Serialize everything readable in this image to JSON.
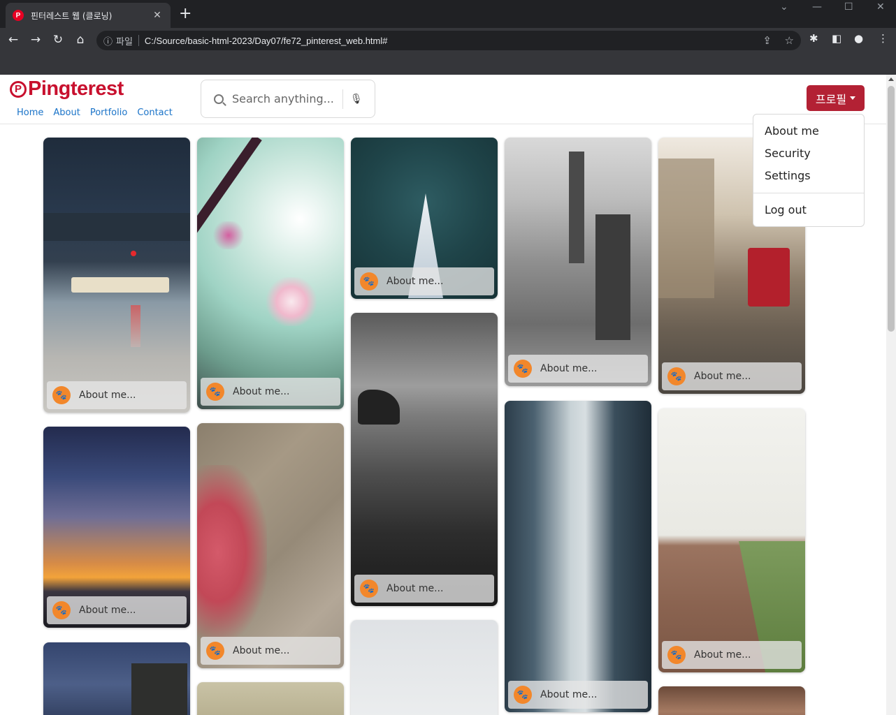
{
  "browser": {
    "tab_title": "핀터레스트 웹 (클로닝)",
    "tab_favicon": "P",
    "new_tab": "+",
    "close": "✕",
    "url_scheme_label": "파일",
    "url": "C:/Source/basic-html-2023/Day07/fe72_pinterest_web.html#"
  },
  "header": {
    "logo_mark": "P",
    "logo_text": "Pingterest",
    "nav": [
      "Home",
      "About",
      "Portfolio",
      "Contact"
    ],
    "search_placeholder": "Search anything...",
    "profile_button": "프로필"
  },
  "dropdown": {
    "items": [
      "About me",
      "Security",
      "Settings"
    ],
    "logout": "Log out"
  },
  "pins": [
    {
      "caption": "About me..."
    },
    {
      "caption": "About me..."
    },
    {
      "caption": "About me..."
    },
    {
      "caption": "About me..."
    },
    {
      "caption": "About me..."
    },
    {
      "caption": "About me..."
    },
    {
      "caption": "About me..."
    },
    {
      "caption": "About me..."
    },
    {
      "caption": "About me..."
    },
    {
      "caption": "About me..."
    }
  ],
  "colors": {
    "brand": "#c8102e",
    "profile_button": "#b32134",
    "link": "#1a73c8",
    "paw": "#f2872b"
  }
}
